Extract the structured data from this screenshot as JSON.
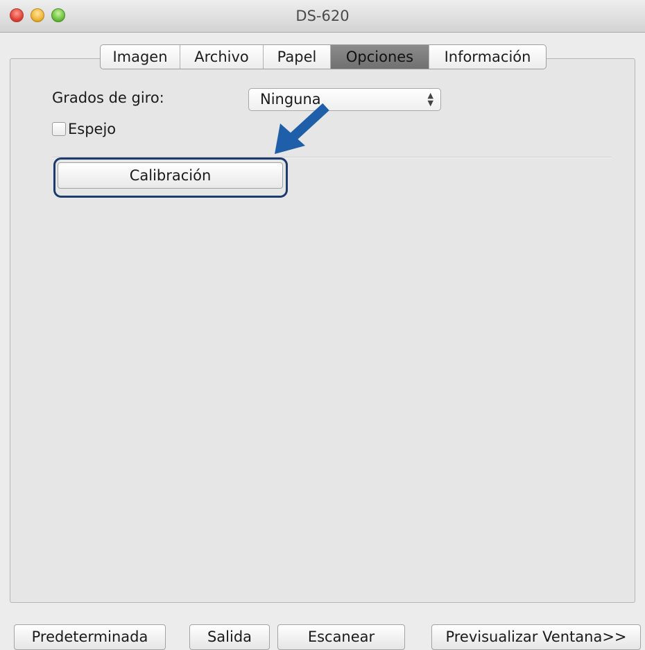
{
  "window": {
    "title": "DS-620"
  },
  "tabs": [
    {
      "label": "Imagen",
      "active": false
    },
    {
      "label": "Archivo",
      "active": false
    },
    {
      "label": "Papel",
      "active": false
    },
    {
      "label": "Opciones",
      "active": true
    },
    {
      "label": "Información",
      "active": false
    }
  ],
  "options": {
    "rotation_label": "Grados de giro:",
    "rotation_value": "Ninguna",
    "mirror_label": "Espejo",
    "mirror_checked": false,
    "calibration_label": "Calibración"
  },
  "footer": {
    "default_label": "Predeterminada",
    "exit_label": "Salida",
    "scan_label": "Escanear",
    "preview_label": "Previsualizar Ventana>>"
  },
  "colors": {
    "annotation_arrow": "#1f5ea8",
    "highlight_border": "#1d3a6c"
  }
}
